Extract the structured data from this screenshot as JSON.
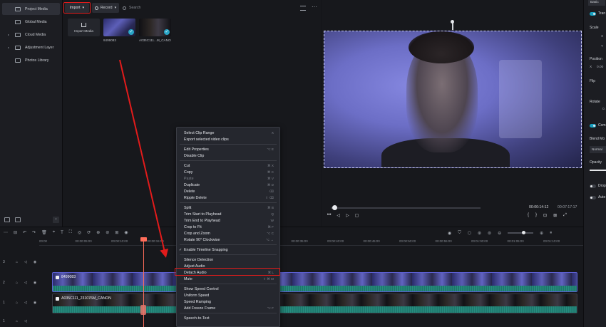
{
  "sidebar": {
    "items": [
      {
        "label": "Project Media",
        "caret": "",
        "active": true
      },
      {
        "label": "Global Media",
        "caret": "",
        "active": false
      },
      {
        "label": "Cloud Media",
        "caret": "▸",
        "active": false
      },
      {
        "label": "Adjustment Layer",
        "caret": "▸",
        "active": false
      },
      {
        "label": "Photos Library",
        "caret": "",
        "active": false
      }
    ],
    "collapse_glyph": "‹"
  },
  "media": {
    "import_label": "Import",
    "record_label": "Record",
    "search_placeholder": "Search",
    "more_glyph": "⋯",
    "cards": [
      {
        "name": "Import Media",
        "inner": "Import Media"
      },
      {
        "name": "8499083"
      },
      {
        "name": "A035C111...M_CANON"
      }
    ]
  },
  "preview": {
    "time_current": "00:00:14:12",
    "time_total": "00:07:17:17",
    "playback_position": 0.01,
    "controls": [
      "⏮",
      "◁",
      "▷",
      "▢"
    ],
    "right_controls": [
      "{",
      "}",
      "⊡",
      "⊠",
      "⤢"
    ]
  },
  "inspector": {
    "tab": "Basic",
    "transform_label": "Tran",
    "scale_label": "Scale",
    "scale_x": "X",
    "scale_y": "Y",
    "position_label": "Position",
    "position_x": "X",
    "position_x_val": "0.00",
    "flip_label": "Flip",
    "rotate_label": "Rotate",
    "rotate_val": "0.",
    "compositing_label": "Com",
    "blend_label": "Blend Mo",
    "blend_value": "Normal",
    "opacity_label": "Opacity",
    "drop_label": "Drop",
    "auto_label": "Auto"
  },
  "timeline": {
    "toolbar_glyphs": [
      "⋯",
      "⊟",
      "↶",
      "↷",
      "🗑",
      "⌖",
      "T",
      "⛶",
      "◎",
      "⟳",
      "⊕",
      "⊘",
      "⊞",
      "◉"
    ],
    "right_glyphs": [
      "◉",
      "⛉",
      "⬡",
      "⊛",
      "⊜",
      "⊖",
      "⊕",
      "⏸"
    ],
    "ruler_ticks": [
      "00:00",
      "00:00:05:00",
      "00:00:10:00",
      "00:00:15:00",
      "00:00:20:00",
      "00:00:25:00",
      "00:00:30:00",
      "00:00:35:00",
      "00:00:40:00",
      "00:00:45:00",
      "00:00:50:00",
      "00:00:55:00",
      "00:01:00:00",
      "00:01:05:00",
      "00:01:10:00"
    ],
    "tracks": [
      {
        "num": "3"
      },
      {
        "num": "2"
      },
      {
        "num": "1"
      },
      {
        "num": "1"
      }
    ],
    "clip_video_name": "8499083",
    "clip_audio_name": "A035C111_231076M_CANON"
  },
  "context_menu": {
    "groups": [
      [
        {
          "label": "Select Clip Range",
          "shortcut": "X",
          "disabled": false
        },
        {
          "label": "Export selected video clips",
          "shortcut": "",
          "disabled": false
        }
      ],
      [
        {
          "label": "Edit Properties",
          "shortcut": "⌥ E",
          "disabled": false
        },
        {
          "label": "Disable Clip",
          "shortcut": "",
          "disabled": false
        }
      ],
      [
        {
          "label": "Cut",
          "shortcut": "⌘ X",
          "disabled": false
        },
        {
          "label": "Copy",
          "shortcut": "⌘ C",
          "disabled": false
        },
        {
          "label": "Paste",
          "shortcut": "⌘ V",
          "disabled": true
        },
        {
          "label": "Duplicate",
          "shortcut": "⌘ D",
          "disabled": false
        },
        {
          "label": "Delete",
          "shortcut": "⌫",
          "disabled": false
        },
        {
          "label": "Ripple Delete",
          "shortcut": "⇧ ⌫",
          "disabled": false
        }
      ],
      [
        {
          "label": "Split",
          "shortcut": "⌘ B",
          "disabled": false
        },
        {
          "label": "Trim Start to Playhead",
          "shortcut": "Q",
          "disabled": false
        },
        {
          "label": "Trim End to Playhead",
          "shortcut": "W",
          "disabled": false
        },
        {
          "label": "Crop to Fit",
          "shortcut": "⌘ F",
          "disabled": false
        },
        {
          "label": "Crop and Zoom",
          "shortcut": "⌥ C",
          "disabled": false
        },
        {
          "label": "Rotate 90° Clockwise",
          "shortcut": "⌥ →",
          "disabled": false
        }
      ],
      [
        {
          "label": "Enable Timeline Snapping",
          "shortcut": "",
          "disabled": false,
          "checked": true
        }
      ],
      [
        {
          "label": "Silence Detection",
          "shortcut": "",
          "disabled": false
        },
        {
          "label": "Adjust Audio",
          "shortcut": "",
          "disabled": false
        },
        {
          "label": "Detach Audio",
          "shortcut": "⌘ L",
          "disabled": false
        },
        {
          "label": "Mute",
          "shortcut": "⇧ ⌘ M",
          "disabled": false
        }
      ],
      [
        {
          "label": "Show Speed Control",
          "shortcut": "",
          "disabled": false
        },
        {
          "label": "Uniform Speed",
          "shortcut": "",
          "disabled": false
        },
        {
          "label": "Speed Ramping",
          "shortcut": "",
          "disabled": false
        },
        {
          "label": "Add Freeze Frame",
          "shortcut": "⌥ F",
          "disabled": false
        }
      ],
      [
        {
          "label": "Speech-to-Text",
          "shortcut": "",
          "disabled": false
        }
      ]
    ],
    "highlighted_item": "Detach Audio"
  },
  "colors": {
    "highlight_red": "#e21b1b",
    "accent_teal": "#29a5c6",
    "playhead": "#ff6d5a",
    "clip_video_border": "#5c5fd1",
    "waveform": "#2fa391"
  }
}
